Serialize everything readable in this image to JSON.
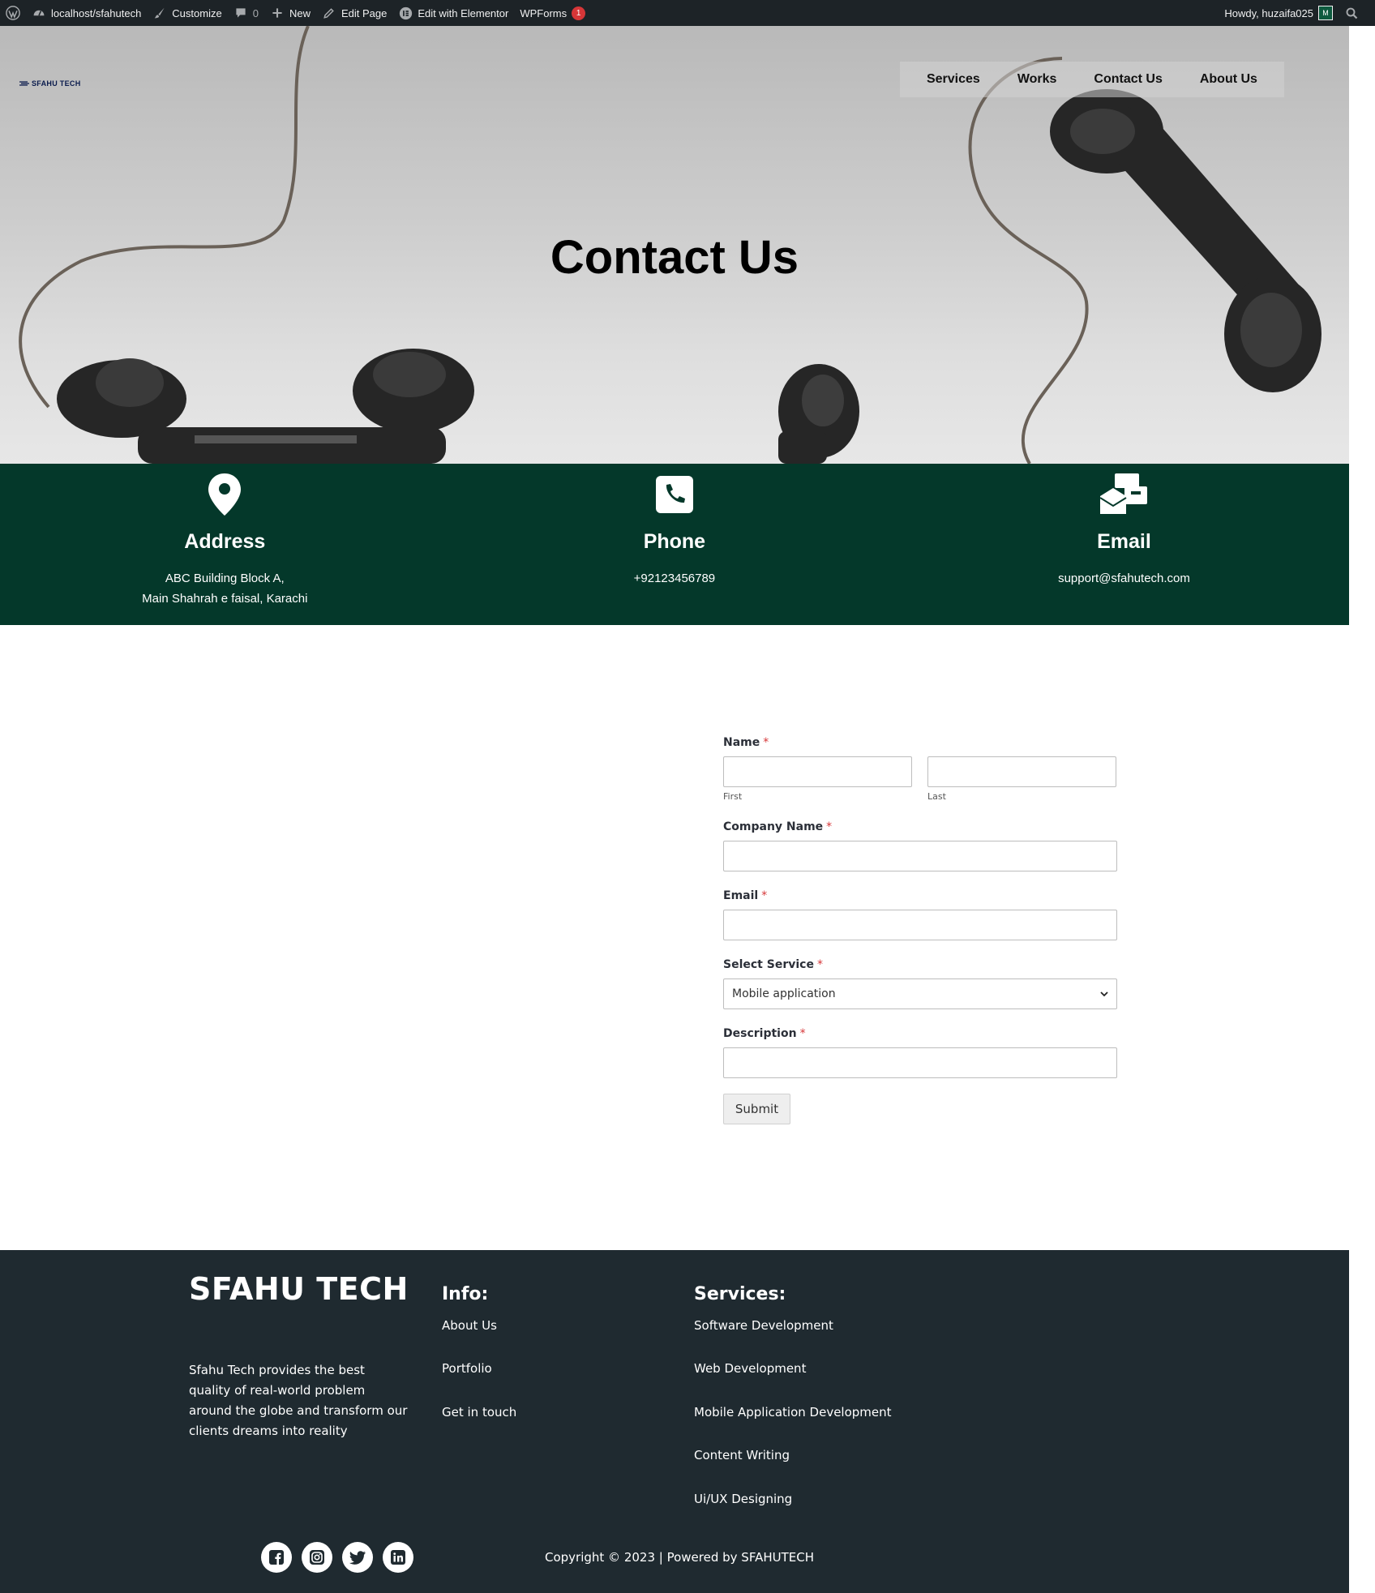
{
  "admin_bar": {
    "site": "localhost/sfahutech",
    "customize": "Customize",
    "comments_count": "0",
    "new": "New",
    "edit_page": "Edit Page",
    "edit_elementor": "Edit with Elementor",
    "wpforms": "WPForms",
    "wpforms_badge": "1",
    "howdy": "Howdy, huzaifa025",
    "avatar_letter": "M"
  },
  "header": {
    "logo_text": "SFAHU TECH",
    "nav": [
      "Services",
      "Works",
      "Contact Us",
      "About Us"
    ]
  },
  "hero": {
    "title": "Contact Us"
  },
  "contact": {
    "address": {
      "heading": "Address",
      "line1": "ABC Building Block A,",
      "line2": "Main Shahrah e faisal, Karachi"
    },
    "phone": {
      "heading": "Phone",
      "value": "+92123456789"
    },
    "email": {
      "heading": "Email",
      "value": "support@sfahutech.com"
    }
  },
  "form": {
    "name_label": "Name",
    "first_sublabel": "First",
    "last_sublabel": "Last",
    "company_label": "Company Name",
    "email_label": "Email",
    "service_label": "Select Service",
    "service_selected": "Mobile application",
    "description_label": "Description",
    "required_mark": "*",
    "submit_label": "Submit"
  },
  "footer": {
    "brand": "SFAHU TECH",
    "description": "Sfahu Tech provides the best quality of real-world problem around the globe and transform our clients dreams into reality",
    "info_title": "Info:",
    "info_links": [
      "About Us",
      "Portfolio",
      "Get in touch"
    ],
    "services_title": "Services:",
    "services_links": [
      "Software Development",
      "Web Development",
      "Mobile Application Development",
      "Content Writing",
      "Ui/UX Designing"
    ],
    "copyright": "Copyright © 2023  | Powered by SFAHUTECH",
    "social_icons": [
      "facebook-icon",
      "instagram-icon",
      "twitter-icon",
      "linkedin-icon"
    ]
  },
  "colors": {
    "admin_bar": "#1d2327",
    "contact_strip": "#04382a",
    "footer": "#1f2a30",
    "required": "#d63638"
  }
}
